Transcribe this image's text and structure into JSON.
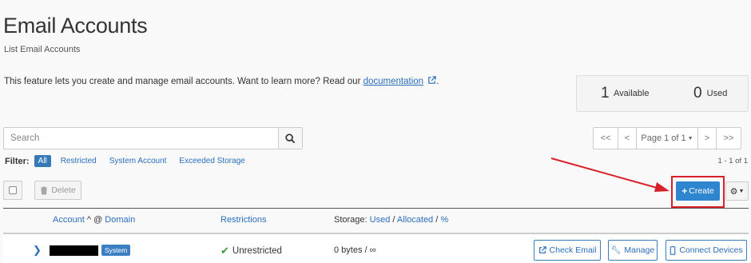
{
  "header": {
    "title": "Email Accounts",
    "subtitle": "List Email Accounts",
    "intro_text": "This feature lets you create and manage email accounts. Want to learn more? Read our ",
    "doc_link": "documentation",
    "intro_suffix": "."
  },
  "stats": {
    "available_count": "1",
    "available_label": "Available",
    "used_count": "0",
    "used_label": "Used"
  },
  "search": {
    "placeholder": "Search",
    "value": "",
    "button_icon": "search-icon"
  },
  "pagination": {
    "first": "<<",
    "prev": "<",
    "page": "Page 1 of 1",
    "next": ">",
    "last": ">>",
    "result_count": "1 - 1 of 1"
  },
  "filter": {
    "label": "Filter:",
    "active": "All",
    "options": [
      "Restricted",
      "System Account",
      "Exceeded Storage"
    ]
  },
  "toolbar": {
    "delete_label": "Delete",
    "create_label": "Create",
    "settings_icon": "gear-icon"
  },
  "table": {
    "headers": {
      "account": "Account",
      "at": "@",
      "domain": "Domain",
      "restrictions": "Restrictions",
      "storage_prefix": "Storage:",
      "used": "Used",
      "sep1": "/",
      "allocated": "Allocated",
      "sep2": "/",
      "percent": "%"
    },
    "rows": [
      {
        "badge": "System",
        "restriction": "Unrestricted",
        "storage": "0 bytes / ∞",
        "actions": [
          "Check Email",
          "Manage",
          "Connect Devices"
        ]
      }
    ]
  },
  "colors": {
    "accent": "#2e86d1",
    "link": "#2a6ebb",
    "highlight": "#d8202a",
    "success": "#3c9a3c"
  }
}
